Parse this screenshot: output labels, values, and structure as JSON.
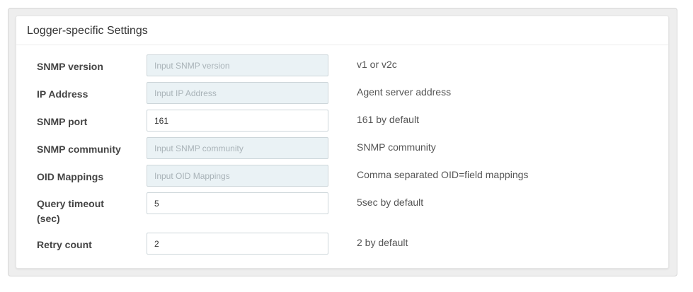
{
  "panel": {
    "title": "Logger-specific Settings"
  },
  "fields": [
    {
      "label": "SNMP version",
      "value": "",
      "placeholder": "Input SNMP version",
      "help": "v1 or v2c"
    },
    {
      "label": "IP Address",
      "value": "",
      "placeholder": "Input IP Address",
      "help": "Agent server address"
    },
    {
      "label": "SNMP port",
      "value": "161",
      "placeholder": "",
      "help": "161 by default"
    },
    {
      "label": "SNMP community",
      "value": "",
      "placeholder": "Input SNMP community",
      "help": "SNMP community"
    },
    {
      "label": "OID Mappings",
      "value": "",
      "placeholder": "Input OID Mappings",
      "help": "Comma separated OID=field mappings"
    },
    {
      "label": "Query timeout (sec)",
      "value": "5",
      "placeholder": "",
      "help": "5sec by default"
    },
    {
      "label": "Retry count",
      "value": "2",
      "placeholder": "",
      "help": "2 by default"
    }
  ],
  "colors": {
    "empty_input_bg": "#eaf2f5",
    "panel_bg": "#ffffff",
    "outer_bg": "#eeeeee"
  }
}
